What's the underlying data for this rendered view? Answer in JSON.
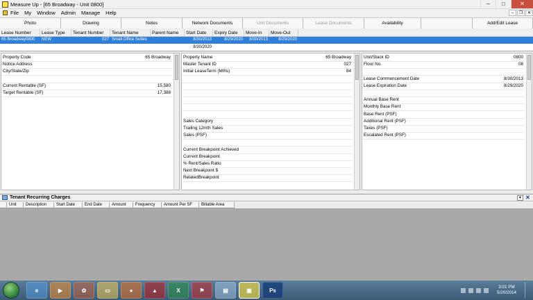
{
  "window": {
    "title": "Measure Up - [65 Broadway - Unit 0800]"
  },
  "menu": [
    "File",
    "My",
    "Window",
    "Admin",
    "Manage",
    "Help"
  ],
  "toolbar": [
    {
      "label": "Photo",
      "enabled": true
    },
    {
      "label": "Drawing",
      "enabled": true
    },
    {
      "label": "Notes",
      "enabled": true
    },
    {
      "label": "Network Documents",
      "enabled": true
    },
    {
      "label": "Unit Documents",
      "enabled": false
    },
    {
      "label": "Lease Documents",
      "enabled": false
    },
    {
      "label": "Availability",
      "enabled": true
    },
    {
      "label": "Add/Edit Lease",
      "enabled": true
    }
  ],
  "lease_table": {
    "headers": [
      "Lease Number",
      "Lease Type",
      "Tenant Number",
      "Tenant Name",
      "Parent Name",
      "Start Date",
      "Expiry Date",
      "Move-In",
      "Move-Out"
    ],
    "rows": [
      [
        "65 Broadway0800",
        "NEW",
        "027",
        "Small Office Suites",
        "",
        "8/30/2013",
        "8/29/2020",
        "8/30/2013",
        "8/29/2020"
      ],
      [
        "",
        "",
        "",
        "",
        "",
        "8/30/2020",
        "",
        "",
        ""
      ]
    ]
  },
  "panel_left": {
    "fields": [
      {
        "label": "Property Code",
        "value": "65 Broadway"
      },
      {
        "label": "Notice Address",
        "value": ""
      },
      {
        "label": "City/State/Zip",
        "value": ""
      },
      {
        "label": "",
        "value": ""
      },
      {
        "label": "Current Rentable (SF)",
        "value": "15,580"
      },
      {
        "label": "Target Rentable (SF)",
        "value": "17,388"
      }
    ]
  },
  "panel_mid": {
    "fields": [
      {
        "label": "Property Name",
        "value": "65 Broadway"
      },
      {
        "label": "Master Tenant ID",
        "value": "027"
      },
      {
        "label": "Initial LeaseTerm (Mths)",
        "value": "84"
      },
      {
        "label": "",
        "value": ""
      },
      {
        "label": "",
        "value": ""
      },
      {
        "label": "",
        "value": ""
      },
      {
        "label": "",
        "value": ""
      },
      {
        "label": "",
        "value": ""
      },
      {
        "label": "",
        "value": ""
      },
      {
        "label": "Sales Category",
        "value": ""
      },
      {
        "label": "Trailing 12mth Sales",
        "value": ""
      },
      {
        "label": "Sales (PSF)",
        "value": ""
      },
      {
        "label": "",
        "value": ""
      },
      {
        "label": "Current Breakpoint Achieved",
        "value": ""
      },
      {
        "label": "Current Breakpoint",
        "value": ""
      },
      {
        "label": "% Rent/Sales Ratio",
        "value": ""
      },
      {
        "label": "Next Breakpoint $",
        "value": ""
      },
      {
        "label": "RelatedBreakpoint",
        "value": ""
      }
    ]
  },
  "panel_right": {
    "fields": [
      {
        "label": "Unit/Stack ID",
        "value": "0800"
      },
      {
        "label": "Floor No.",
        "value": "08"
      },
      {
        "label": "",
        "value": ""
      },
      {
        "label": "Lease Commencement Date",
        "value": "8/30/2013"
      },
      {
        "label": "Lease Expiration Date",
        "value": "8/29/2020"
      },
      {
        "label": "",
        "value": ""
      },
      {
        "label": "Annual Base Rent",
        "value": ""
      },
      {
        "label": "Monthly Base Rent",
        "value": ""
      },
      {
        "label": "Base Rent (PSF)",
        "value": ""
      },
      {
        "label": "Additional Rent (PSF)",
        "value": ""
      },
      {
        "label": "Taxes (PSF)",
        "value": ""
      },
      {
        "label": "Escalated Rent (PSF)",
        "value": ""
      }
    ]
  },
  "recurring": {
    "title": "Tenant Recurring Charges",
    "headers": [
      "Unit",
      "Description",
      "Start Date",
      "End Date",
      "Amount",
      "Frequency",
      "Amount Per SF",
      "Billable Area"
    ]
  },
  "taskbar": {
    "apps": [
      "ie-icon",
      "media-player-icon",
      "paint-icon",
      "folder-icon",
      "firefox-icon",
      "acrobat-icon",
      "excel-icon",
      "pdf-icon",
      "notepad-icon",
      "measureup-icon",
      "photoshop-icon"
    ],
    "time": "3:01 PM",
    "date": "5/20/2014"
  },
  "colors": {
    "selection": "#2f80dd",
    "grid_bg": "#a9a9a9",
    "taskbar": "#3b5a76"
  }
}
